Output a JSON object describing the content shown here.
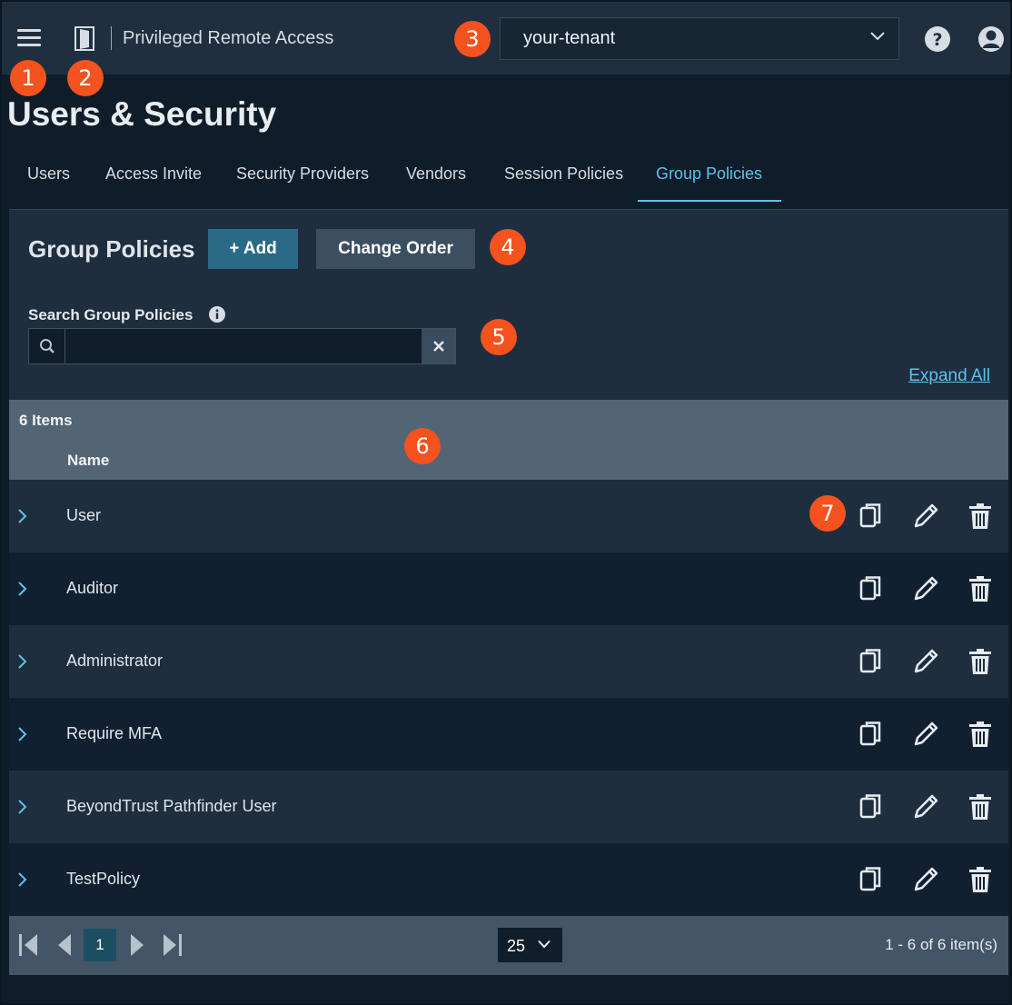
{
  "header": {
    "app_title": "Privileged Remote Access",
    "tenant": "your-tenant",
    "icons": [
      "menu-icon",
      "door-icon",
      "help-icon",
      "user-icon"
    ]
  },
  "page": {
    "title": "Users & Security"
  },
  "tabs": [
    {
      "label": "Users"
    },
    {
      "label": "Access Invite"
    },
    {
      "label": "Security Providers"
    },
    {
      "label": "Vendors"
    },
    {
      "label": "Session Policies"
    },
    {
      "label": "Group Policies"
    }
  ],
  "active_tab": "Group Policies",
  "section": {
    "title": "Group Policies",
    "add_label": "+ Add",
    "change_order_label": "Change Order"
  },
  "search": {
    "label": "Search Group Policies",
    "value": ""
  },
  "expand_all": "Expand All",
  "grid": {
    "items_count": "6 Items",
    "column_name": "Name",
    "rows": [
      {
        "name": "User"
      },
      {
        "name": "Auditor"
      },
      {
        "name": "Administrator"
      },
      {
        "name": "Require MFA"
      },
      {
        "name": "BeyondTrust Pathfinder User"
      },
      {
        "name": "TestPolicy"
      }
    ]
  },
  "pager": {
    "page": "1",
    "page_size": "25",
    "info": "1 - 6 of 6 item(s)"
  },
  "callouts": [
    "1",
    "2",
    "3",
    "4",
    "5",
    "6",
    "7"
  ],
  "colors": {
    "accent": "#5cc3e8",
    "primary_button": "#2a6a87",
    "callout": "#f4521e"
  }
}
